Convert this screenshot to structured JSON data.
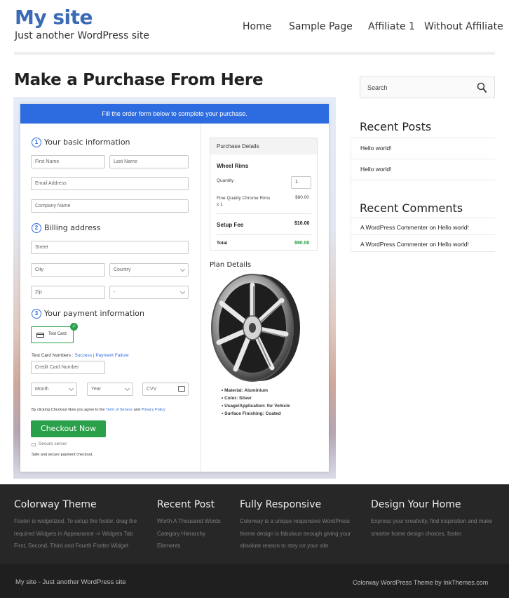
{
  "header": {
    "site_title": "My site",
    "tagline": "Just another WordPress site",
    "nav": [
      "Home",
      "Sample Page",
      "Affiliate 1",
      "Without Affiliate"
    ]
  },
  "page": {
    "title": "Make a Purchase From Here"
  },
  "form": {
    "banner": "Fill the order form below to complete your purchase.",
    "steps": [
      {
        "num": "1",
        "title": "Your basic information"
      },
      {
        "num": "2",
        "title": "Billing address"
      },
      {
        "num": "3",
        "title": "Your payment information"
      }
    ],
    "placeholders": {
      "first_name": "First Name",
      "last_name": "Last Name",
      "email": "Email Address",
      "company": "Company Name",
      "street": "Street",
      "city": "City",
      "country": "Country",
      "zip": "Zip",
      "state": "-",
      "card_number": "Credit Card Number",
      "month": "Month",
      "year": "Year",
      "cvv": "CVV"
    },
    "test_card_label": "Test Card",
    "test_card_numbers_label": "Test Card Numbers :",
    "success_link": "Success",
    "separator": "|",
    "failure_link": "Payment Failure",
    "agree_prefix": "By clicking Checkout Now you agree to the",
    "terms_link": "Term of Service",
    "agree_and": "and",
    "privacy_link": "Privacy Policy",
    "checkout_button": "Checkout Now",
    "secure_server": "Secure server",
    "safe_note": "Safe and secure payment checkout."
  },
  "purchase": {
    "header": "Purchase Details",
    "product": "Wheel Rims",
    "quantity_label": "Quantity",
    "quantity_value": "1",
    "item_name": "Fine Quality Chrome Rims x 1",
    "item_price": "$80.00",
    "setup_fee_label": "Setup Fee",
    "setup_fee_value": "$10.00",
    "total_label": "Total",
    "total_value": "$90.00",
    "total_color": "#2aa04a"
  },
  "plan": {
    "title": "Plan Details",
    "features": [
      "Material: Aluminium",
      "Color: Silver",
      "Usage/Application: for Vehicle",
      "Surface Finishing: Coated"
    ]
  },
  "sidebar": {
    "search_placeholder": "Search",
    "recent_posts_title": "Recent Posts",
    "recent_posts": [
      "Hello world!",
      "Hello world!"
    ],
    "recent_comments_title": "Recent Comments",
    "recent_comments": [
      "A WordPress Commenter on Hello world!",
      "A WordPress Commenter on Hello world!"
    ]
  },
  "footer": {
    "columns": [
      {
        "title": "Colorway Theme",
        "lines": [
          "Footer is widgetized. To setup the footer, drag the",
          "required Widgets in Appearance -> Widgets Tab",
          "First, Second, Third and Fourth Footer Widget"
        ]
      },
      {
        "title": "Recent Post",
        "lines": [
          "Worth A Thousand Words",
          "Category Hierarchy",
          "Elements"
        ]
      },
      {
        "title": "Fully Responsive",
        "lines": [
          "Colorway is a unique responsive WordPress",
          "theme design is fabulous enough giving your",
          "absolute reason to stay on your site."
        ]
      },
      {
        "title": "Design Your Home",
        "lines": [
          "Express your creativity, find inspiration and make",
          "smarter home design choices, faster."
        ]
      }
    ],
    "bottom_left": "My site - Just another WordPress site",
    "bottom_right": "Colorway WordPress Theme by InkThemes.com"
  },
  "colors": {
    "brand_blue": "#3b6bb5",
    "form_blue": "#2d6be0",
    "accent_green": "#2aa04a"
  }
}
